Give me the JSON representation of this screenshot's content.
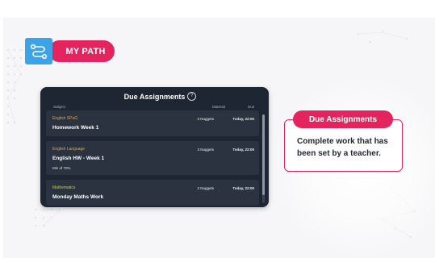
{
  "badge": {
    "label": "MY PATH",
    "icon": "route-icon",
    "color": "#e3245f",
    "icon_color": "#3ba3e6"
  },
  "panel": {
    "title": "Due Assignments",
    "help_icon": "question-circle-icon",
    "columns": {
      "subject": "Subject",
      "material": "Material",
      "due": "Due"
    },
    "rows": [
      {
        "subject": "English SPaG",
        "subject_color": "#e8a23a",
        "title": "Homework Week 1",
        "note": "",
        "material": "3 Nuggets",
        "due": "Today, 22:00"
      },
      {
        "subject": "English Language",
        "subject_color": "#e8a23a",
        "title": "English HW - Week 1",
        "note": "Min of 70%",
        "material": "3 Nuggets",
        "due": "Today, 22:00"
      },
      {
        "subject": "Mathematics",
        "subject_color": "#c8d12e",
        "title": "Monday Maths Work",
        "note": "",
        "material": "2 Nuggets",
        "due": "Today, 22:00"
      }
    ]
  },
  "callout": {
    "tag": "Due Assignments",
    "text": "Complete work that has been set by a teacher."
  }
}
